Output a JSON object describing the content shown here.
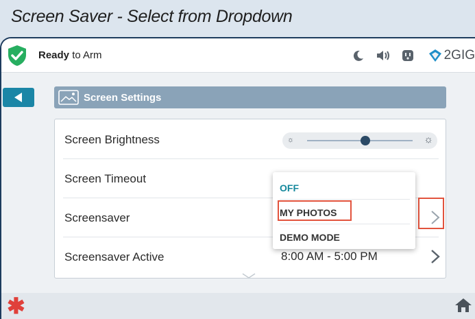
{
  "caption": "Screen Saver - Select from Dropdown",
  "status_bar": {
    "arm_status_bold": "Ready",
    "arm_status_rest": " to Arm",
    "icons": [
      "moon-icon",
      "speaker-icon",
      "outlet-icon"
    ],
    "brand": "2GIG"
  },
  "panel": {
    "title": "Screen Settings",
    "icon": "screen-image-icon"
  },
  "settings": {
    "brightness_label": "Screen Brightness",
    "brightness_level": 0.55,
    "timeout_label": "Screen Timeout",
    "screensaver_label": "Screensaver",
    "screensaver_active_label": "Screensaver Active",
    "screensaver_active_value": "8:00 AM - 5:00 PM"
  },
  "dropdown": {
    "options": [
      "OFF",
      "MY PHOTOS",
      "DEMO MODE"
    ],
    "selected": "OFF",
    "highlighted": "MY PHOTOS"
  },
  "colors": {
    "accent": "#14889c",
    "highlight_box": "#e2533d",
    "armed_ok": "#27ae60",
    "header": "#8aa3b8"
  }
}
